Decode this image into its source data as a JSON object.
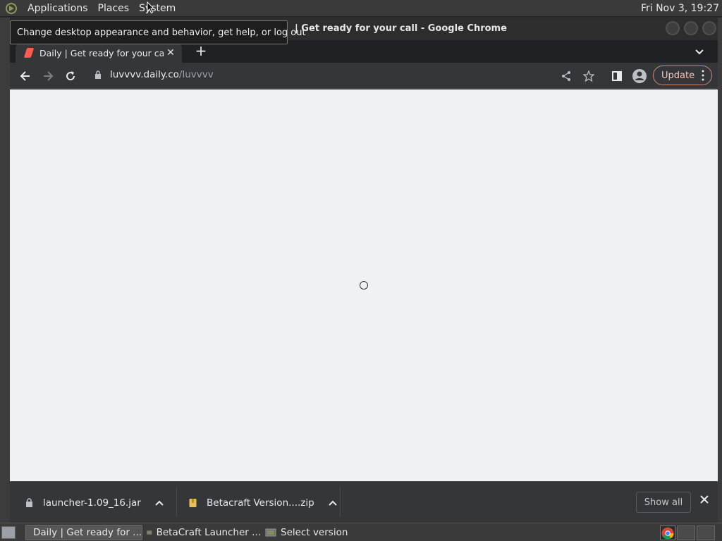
{
  "top_panel": {
    "menus": [
      "Applications",
      "Places",
      "System"
    ],
    "clock": "Fri Nov  3, 19:27"
  },
  "window": {
    "title": "| Get ready for your call - Google Chrome"
  },
  "tooltip": {
    "text": "Change desktop appearance and behavior, get help, or log out"
  },
  "tabs": [
    {
      "title": "Daily | Get ready for your call",
      "favicon": "daily-logo-icon"
    }
  ],
  "toolbar": {
    "url_host": "luvvvv.daily.co",
    "url_path": "/luvvvv",
    "update_label": "Update"
  },
  "downloads": [
    {
      "filename": "launcher-1.09_16.jar",
      "icon": "lock-file-icon"
    },
    {
      "filename": "Betacraft Version....zip",
      "icon": "zip-file-icon"
    }
  ],
  "shelf": {
    "show_all_label": "Show all"
  },
  "taskbar": {
    "tasks": [
      {
        "label": "Daily | Get ready for ...",
        "icon": "chrome-icon",
        "active": true
      },
      {
        "label": "BetaCraft Launcher ...",
        "icon": "java-app-icon",
        "active": false
      },
      {
        "label": "Select version",
        "icon": "java-app-icon",
        "active": false
      }
    ]
  },
  "colors": {
    "page_bg": "#eff2f5",
    "chrome_toolbar": "#35363a",
    "update_accent": "#c98a7a"
  }
}
